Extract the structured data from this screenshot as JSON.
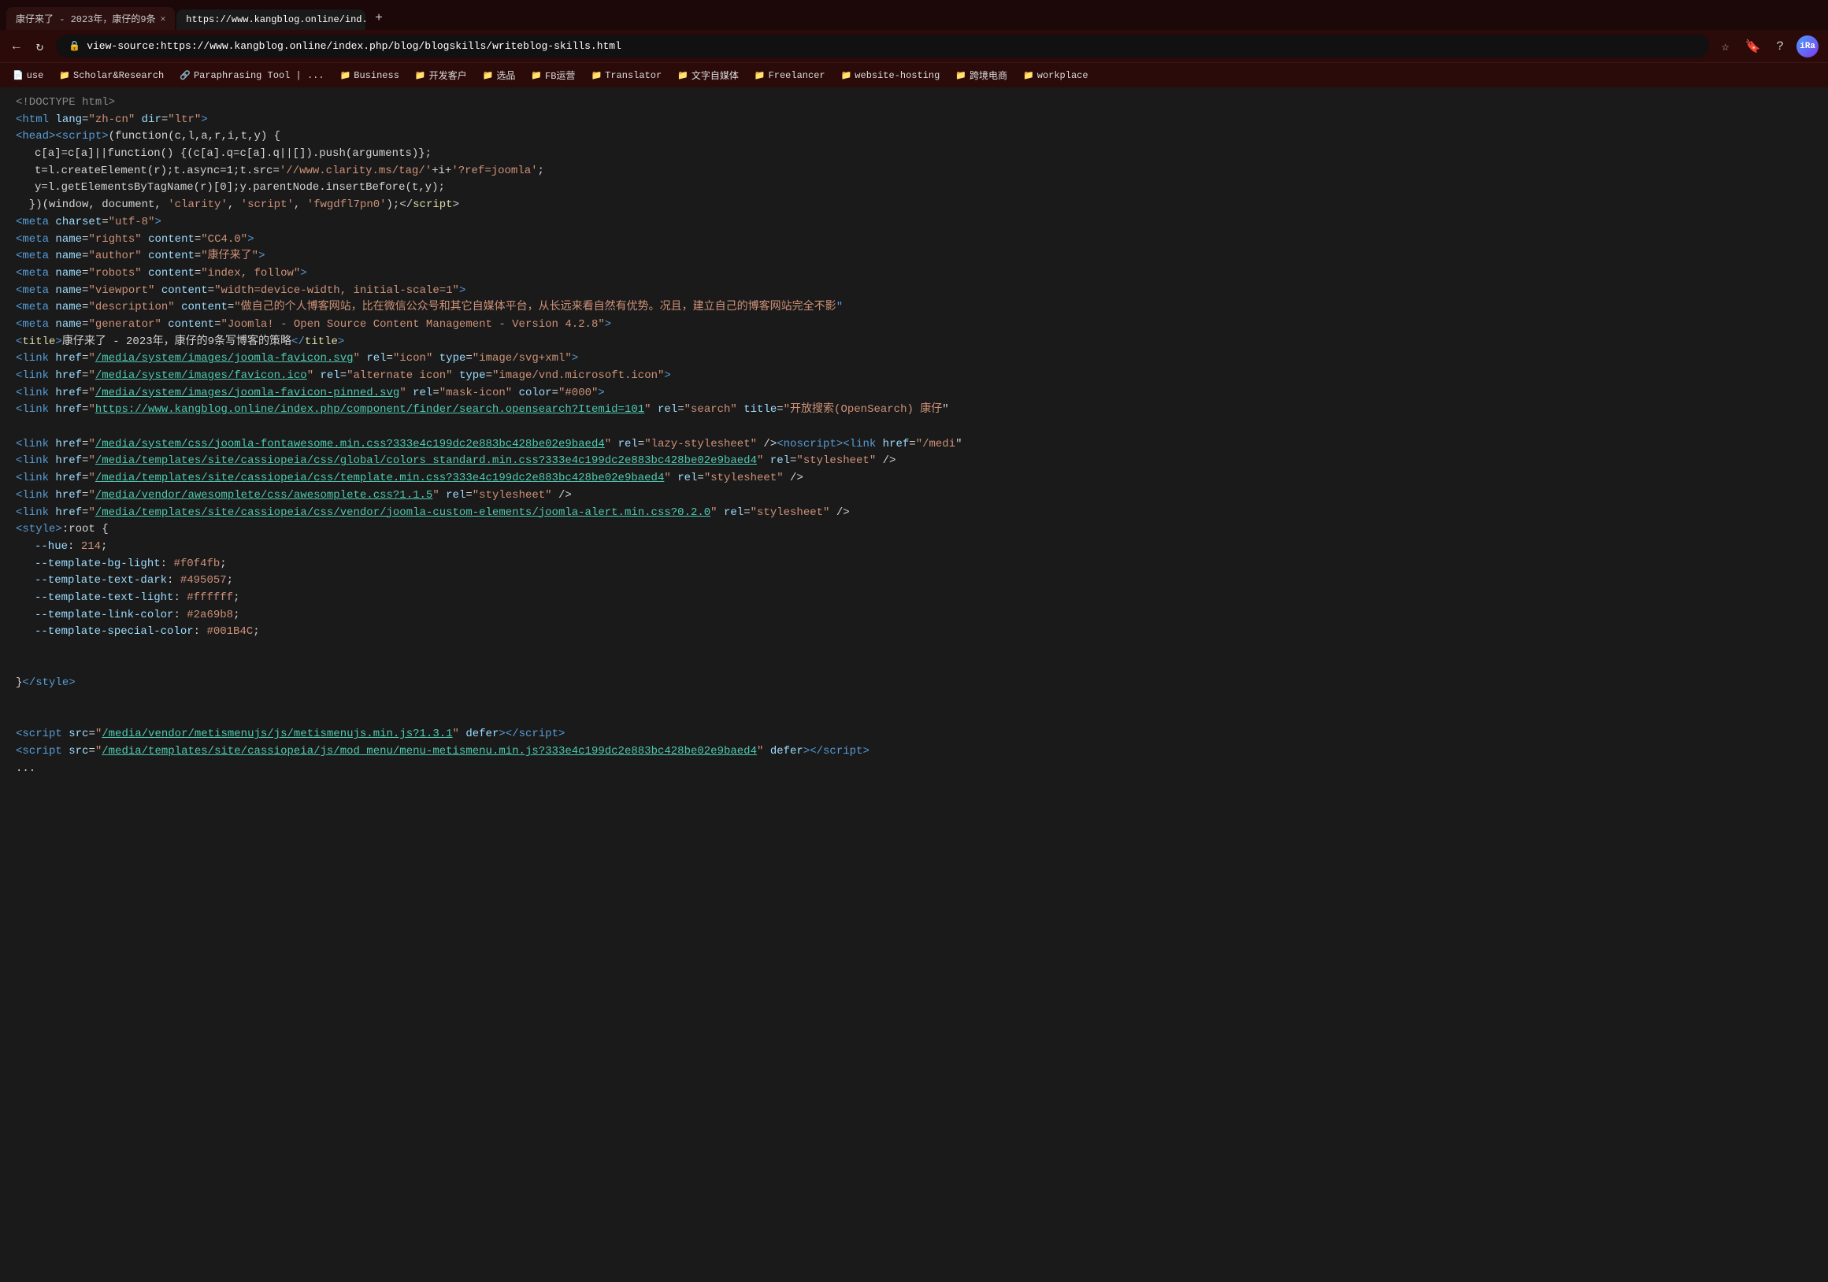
{
  "browser": {
    "tabs": [
      {
        "id": "tab1",
        "label": "康仔来了 - 2023年，康仔的9条...",
        "active": false,
        "url": ""
      },
      {
        "id": "tab2",
        "label": "https://www.kangblog.online/ind...",
        "active": true,
        "url": ""
      }
    ],
    "new_tab_label": "+",
    "address": "view-source:https://www.kangblog.online/index.php/blog/blogskills/writeblog-skills.html",
    "nav_back": "←",
    "nav_reload": "↻",
    "bookmark_star": "☆",
    "toolbar_icons": [
      "🔖",
      "?",
      "👤"
    ]
  },
  "bookmarks": [
    {
      "label": "use",
      "icon": "📄"
    },
    {
      "label": "Scholar&Research",
      "icon": "📁"
    },
    {
      "label": "Paraphrasing Tool | ...",
      "icon": "🔗"
    },
    {
      "label": "Business",
      "icon": "📁"
    },
    {
      "label": "开发客户",
      "icon": "📁"
    },
    {
      "label": "选品",
      "icon": "📁"
    },
    {
      "label": "FB运营",
      "icon": "📁"
    },
    {
      "label": "Translator",
      "icon": "📁"
    },
    {
      "label": "文字自媒体",
      "icon": "📁"
    },
    {
      "label": "Freelancer",
      "icon": "📁"
    },
    {
      "label": "website-hosting",
      "icon": "📁"
    },
    {
      "label": "跨境电商",
      "icon": "📁"
    },
    {
      "label": "workplace",
      "icon": "📁"
    }
  ],
  "source_code": {
    "lines": []
  }
}
